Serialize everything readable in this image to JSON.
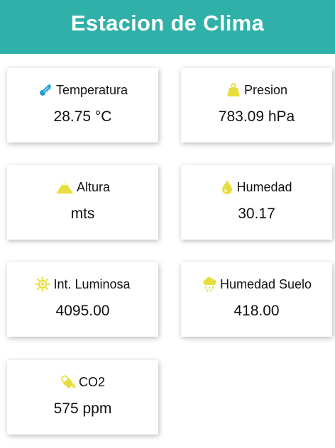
{
  "header": {
    "title": "Estacion de Clima"
  },
  "colors": {
    "accent": "#2fb0a8",
    "icon_yellow": "#e6de3c",
    "icon_blue": "#1c9bd8"
  },
  "cards": [
    {
      "label": "Temperatura",
      "value": "28.75 °C",
      "icon": "thermometer-icon"
    },
    {
      "label": "Presion",
      "value": "783.09 hPa",
      "icon": "weight-icon"
    },
    {
      "label": "Altura",
      "value": "mts",
      "icon": "mountain-icon"
    },
    {
      "label": "Humedad",
      "value": "30.17",
      "icon": "water-drop-icon"
    },
    {
      "label": "Int. Luminosa",
      "value": "4095.00",
      "icon": "sun-icon"
    },
    {
      "label": "Humedad Suelo",
      "value": "418.00",
      "icon": "cloud-rain-icon"
    },
    {
      "label": "CO2",
      "value": "575 ppm",
      "icon": "fill-bucket-icon"
    }
  ]
}
